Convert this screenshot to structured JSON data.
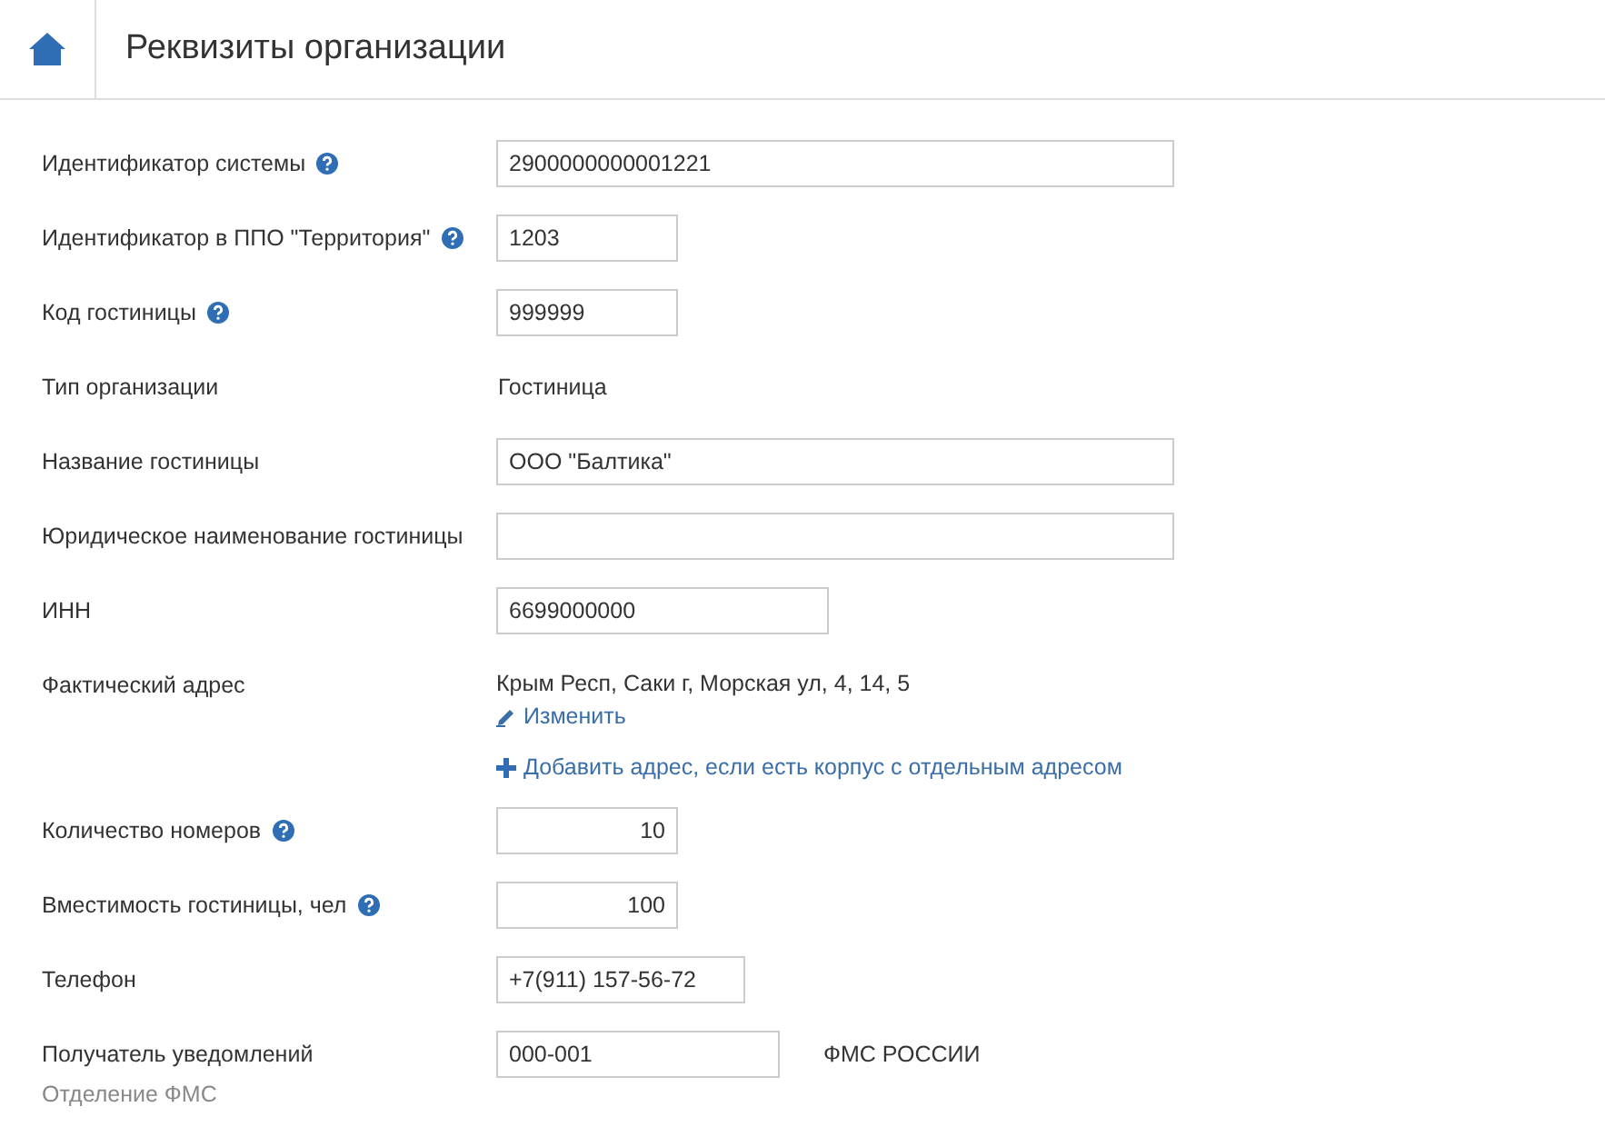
{
  "header": {
    "title": "Реквизиты организации"
  },
  "rows": [
    {
      "kind": "text",
      "label": "Идентификатор системы",
      "help": true,
      "value": "2900000000001221"
    },
    {
      "kind": "text",
      "label": "Идентификатор в ППО \"Территория\"",
      "help": true,
      "value": "1203"
    },
    {
      "kind": "text",
      "label": "Код гостиницы",
      "help": true,
      "value": "999999"
    },
    {
      "kind": "static",
      "label": "Тип организации",
      "help": false,
      "value": "Гостиница"
    },
    {
      "kind": "text",
      "label": "Название гостиницы",
      "help": false,
      "value": "ООО \"Балтика\""
    },
    {
      "kind": "text",
      "label": "Юридическое наименование гостиницы",
      "help": false,
      "value": ""
    },
    {
      "kind": "text",
      "label": "ИНН",
      "help": false,
      "value": "6699000000"
    },
    {
      "kind": "address",
      "label": "Фактический адрес",
      "help": false,
      "value": "Крым Респ, Саки г, Морская ул, 4, 14, 5",
      "edit_link": "Изменить",
      "add_link": "Добавить адрес, если есть корпус с отдельным адресом"
    },
    {
      "kind": "number",
      "label": "Количество номеров",
      "help": true,
      "value": "10"
    },
    {
      "kind": "number",
      "label": "Вместимость гостиницы, чел",
      "help": true,
      "value": "100"
    },
    {
      "kind": "text",
      "label": "Телефон",
      "help": false,
      "value": "+7(911) 157-56-72"
    },
    {
      "kind": "recipient",
      "label": "Получатель уведомлений",
      "help": false,
      "value": "000-001",
      "note": "ФМС РОССИИ",
      "sublabel": "Отделение ФМС"
    }
  ]
}
